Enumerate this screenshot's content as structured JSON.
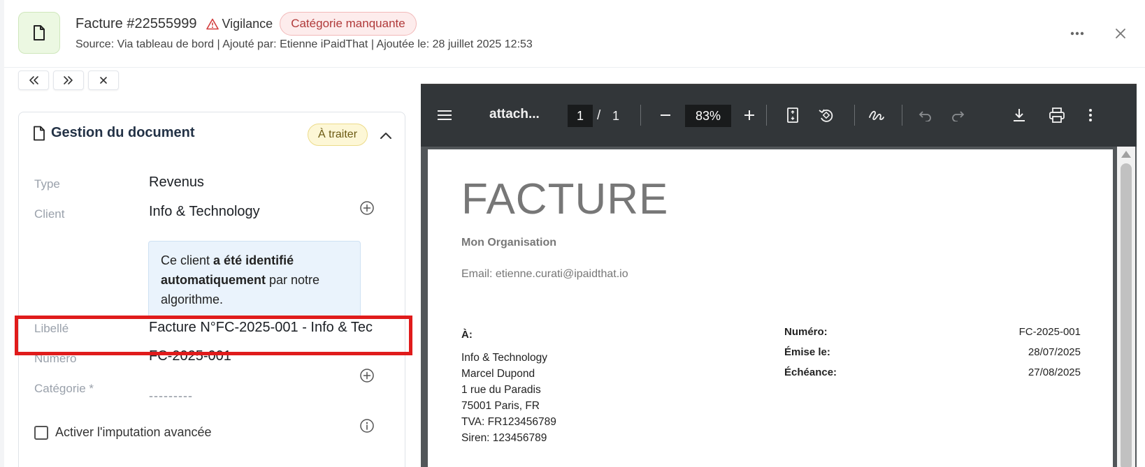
{
  "header": {
    "title": "Facture #22555999",
    "vigilance_label": "Vigilance",
    "missing_category_badge": "Catégorie manquante",
    "source_line": "Source:  Via tableau de bord | Ajouté par: Etienne iPaidThat | Ajoutée le: 28 juillet 2025 12:53"
  },
  "nav": {
    "first": "«",
    "last": "»",
    "close": "×"
  },
  "document_card": {
    "title": "Gestion du document",
    "status": "À traiter",
    "fields": {
      "type_label": "Type",
      "type_value": "Revenus",
      "client_label": "Client",
      "client_value": "Info & Technology",
      "libelle_label": "Libellé",
      "libelle_value": "Facture N°FC-2025-001 - Info & Tec",
      "numero_label": "Numéro",
      "numero_value": "FC-2025-001",
      "categorie_label": "Catégorie *",
      "categorie_value": "---------"
    },
    "info_box": {
      "part1": "Ce client ",
      "part2": "a été identifié automatiquement",
      "part3": " par notre algorithme."
    },
    "advanced_imputation_label": "Activer l'imputation avancée"
  },
  "pdf_viewer": {
    "file_name": "attach...",
    "current_page": "1",
    "page_separator": "/",
    "total_pages": "1",
    "zoom": "83%"
  },
  "invoice": {
    "heading": "FACTURE",
    "organisation": "Mon Organisation",
    "email": "Email: etienne.curati@ipaidthat.io",
    "to_label": "À:",
    "address_lines": [
      "Info & Technology",
      "Marcel Dupond",
      "1 rue du Paradis",
      "75001 Paris, FR",
      "TVA: FR123456789",
      "Siren: 123456789"
    ],
    "meta": [
      {
        "key": "Numéro:",
        "value": "FC-2025-001"
      },
      {
        "key": "Émise le:",
        "value": "28/07/2025"
      },
      {
        "key": "Échéance:",
        "value": "27/08/2025"
      }
    ]
  },
  "colors": {
    "highlight": "#e01b1b",
    "pdf_toolbar": "#323639",
    "status_pill_bg": "#fdf7d6",
    "missing_badge_text": "#b03a3a",
    "info_box_bg": "#eaf3fc"
  }
}
